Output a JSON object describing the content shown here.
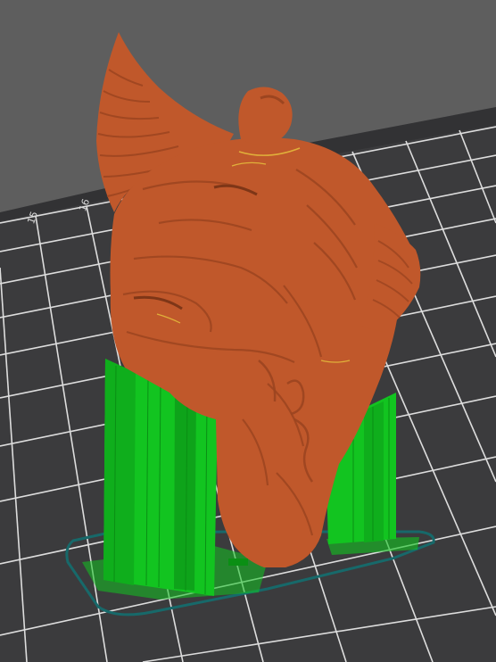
{
  "viewport": {
    "background_color": "#5e5e5e",
    "bed": {
      "surface_color": "#3b3b3d",
      "grid_color": "#e6e6e6",
      "edge_color": "#323234",
      "labels": [
        "15",
        "16"
      ]
    },
    "model": {
      "color": "#c0582b",
      "shadow_color": "#9c4520",
      "highlight_color": "#d86c3a",
      "seam_color": "#e0b03a"
    },
    "supports": {
      "color": "#12c420",
      "dark_color": "#0a8f14"
    },
    "skirt": {
      "color": "#17696a"
    }
  }
}
